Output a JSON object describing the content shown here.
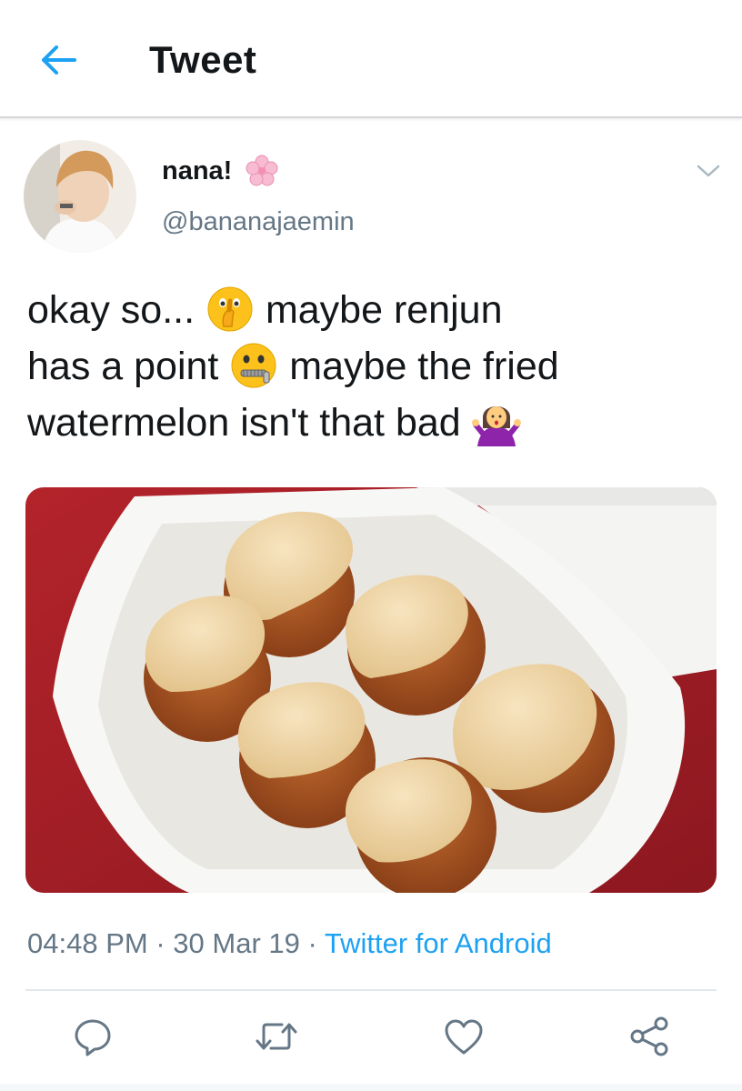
{
  "header": {
    "title": "Tweet"
  },
  "tweet": {
    "display_name": "nana!",
    "handle": "@bananajaemin",
    "text_parts": [
      "okay so...",
      "maybe renjun",
      "has a point",
      "maybe the fried",
      "watermelon isn't that bad"
    ],
    "timestamp": "04:48 PM",
    "date": "30 Mar 19",
    "source": "Twitter for Android",
    "separator": "·"
  },
  "icons": {
    "back": "back-arrow-icon",
    "caret": "chevron-down-icon",
    "reply": "reply-icon",
    "retweet": "retweet-icon",
    "like": "heart-icon",
    "share": "share-icon"
  },
  "colors": {
    "accent": "#1da1f2",
    "secondary_text": "#657786",
    "photo_background": "#9b1c24"
  }
}
